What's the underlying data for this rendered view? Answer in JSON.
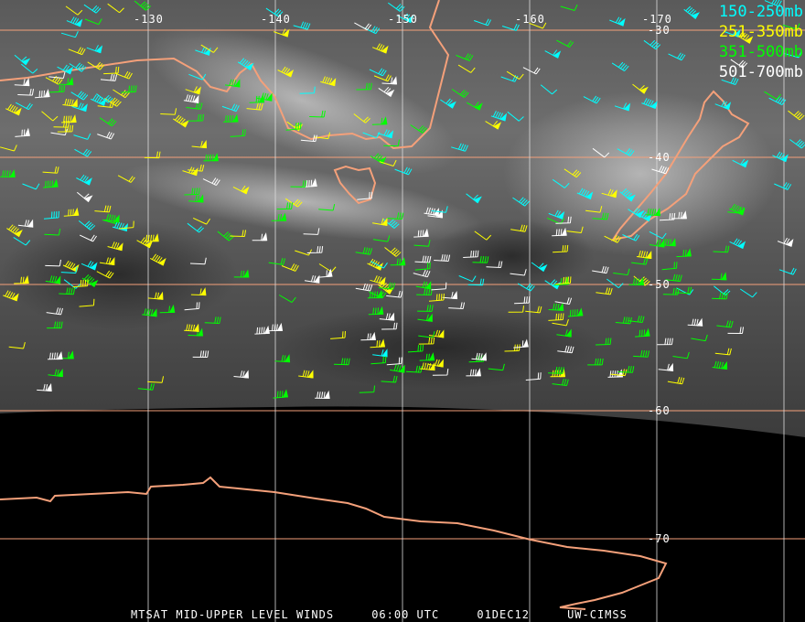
{
  "title": "MTSAT MID-UPPER LEVEL WINDS",
  "time": "06:00 UTC",
  "date": "01DEC12",
  "credit": "UW-CIMSS",
  "legend": [
    {
      "label": "150-250mb",
      "color": "#00ffff"
    },
    {
      "label": "251-350mb",
      "color": "#ffff00"
    },
    {
      "label": "351-500mb",
      "color": "#00ff00"
    },
    {
      "label": "501-700mb",
      "color": "#ffffff"
    }
  ],
  "longitude_labels": [
    "-130",
    "-140",
    "-150",
    "-160",
    "-170"
  ],
  "latitude_labels": [
    "-30",
    "-40",
    "-50",
    "-60",
    "-70"
  ],
  "colors": {
    "coastline": "#f4a07a",
    "grid": "#f4a07a",
    "background": "#000000"
  }
}
